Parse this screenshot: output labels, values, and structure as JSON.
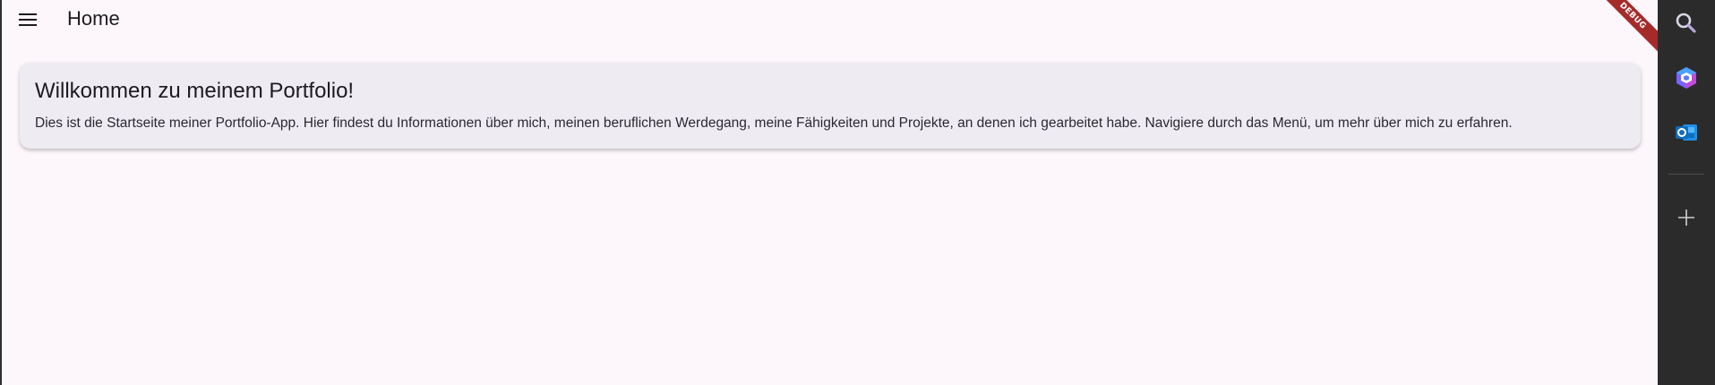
{
  "appbar": {
    "title": "Home",
    "menu_icon": "hamburger-menu-icon"
  },
  "debug_banner": {
    "label": "DEBUG",
    "color": "#a52b2b"
  },
  "welcome_card": {
    "title": "Willkommen zu meinem Portfolio!",
    "body": "Dies ist die Startseite meiner Portfolio-App. Hier findest du Informationen über mich, meinen beruflichen Werdegang, meine Fähigkeiten und Projekte, an denen ich gearbeitet habe. Navigiere durch das Menü, um mehr über mich zu erfahren."
  },
  "side_rail": {
    "items": [
      {
        "icon": "search-icon"
      },
      {
        "icon": "copilot-icon"
      },
      {
        "icon": "outlook-icon"
      },
      {
        "icon": "add-icon"
      }
    ]
  },
  "colors": {
    "page_background": "#fdf7fc",
    "card_background": "#efebf3",
    "rail_background": "#2b2b2b"
  }
}
